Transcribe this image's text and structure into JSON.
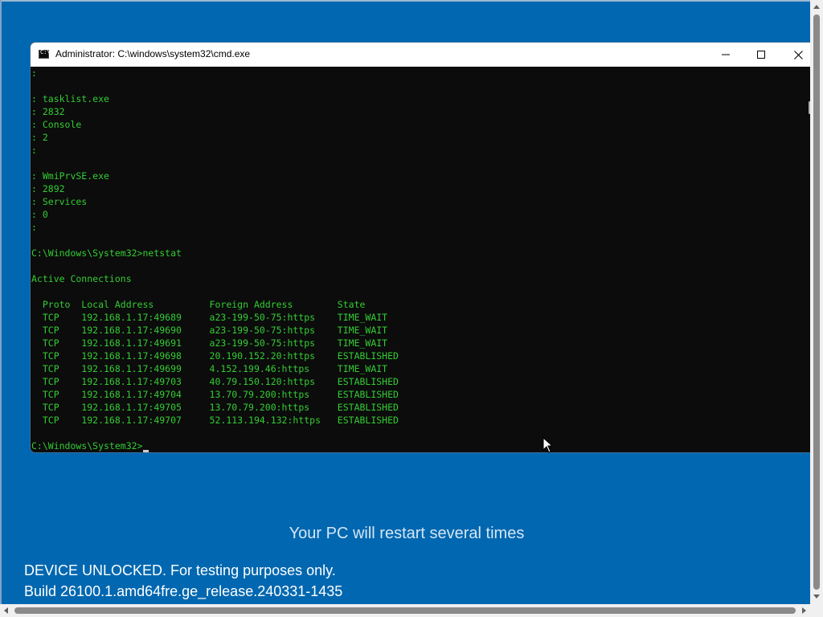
{
  "window": {
    "title": "Administrator: C:\\windows\\system32\\cmd.exe",
    "icon": "cmd-icon",
    "icon_glyph": "C:\\",
    "controls": [
      "minimize-icon",
      "maximize-icon",
      "close-icon"
    ]
  },
  "console": {
    "text_color": "#33cc33",
    "background": "#0c0c0c",
    "lines": [
      ":",
      "",
      ": tasklist.exe",
      ": 2832",
      ": Console",
      ": 2",
      ":",
      "",
      ": WmiPrvSE.exe",
      ": 2892",
      ": Services",
      ": 0",
      ":",
      "",
      "C:\\Windows\\System32>netstat",
      "",
      "Active Connections",
      "",
      "  Proto  Local Address          Foreign Address        State",
      "  TCP    192.168.1.17:49689     a23-199-50-75:https    TIME_WAIT",
      "  TCP    192.168.1.17:49690     a23-199-50-75:https    TIME_WAIT",
      "  TCP    192.168.1.17:49691     a23-199-50-75:https    TIME_WAIT",
      "  TCP    192.168.1.17:49698     20.190.152.20:https    ESTABLISHED",
      "  TCP    192.168.1.17:49699     4.152.199.46:https     TIME_WAIT",
      "  TCP    192.168.1.17:49703     40.79.150.120:https    ESTABLISHED",
      "  TCP    192.168.1.17:49704     13.70.79.200:https     ESTABLISHED",
      "  TCP    192.168.1.17:49705     13.70.79.200:https     ESTABLISHED",
      "  TCP    192.168.1.17:49707     52.113.194.132:https   ESTABLISHED",
      ""
    ],
    "prompt": "C:\\Windows\\System32>"
  },
  "setup": {
    "restart_message": "Your PC will restart several times",
    "watermark_line1": "DEVICE UNLOCKED. For testing purposes only.",
    "watermark_line2": "Build 26100.1.amd64fre.ge_release.240331-1435",
    "background_color": "#0067b0"
  }
}
